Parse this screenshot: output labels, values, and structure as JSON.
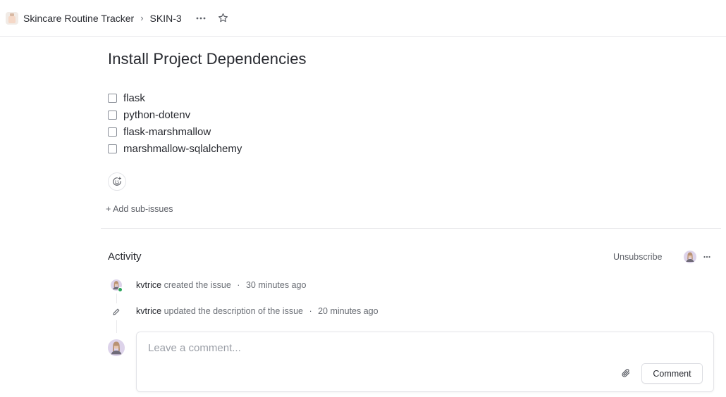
{
  "header": {
    "project_name": "Skincare Routine Tracker",
    "separator": "›",
    "issue_id": "SKIN-3"
  },
  "issue": {
    "title": "Install Project Dependencies",
    "checklist": [
      {
        "label": "flask",
        "checked": false
      },
      {
        "label": "python-dotenv",
        "checked": false
      },
      {
        "label": "flask-marshmallow",
        "checked": false
      },
      {
        "label": "marshmallow-sqlalchemy",
        "checked": false
      }
    ],
    "add_sub_issues": "+ Add sub-issues"
  },
  "activity": {
    "title": "Activity",
    "unsubscribe": "Unsubscribe",
    "events": [
      {
        "actor": "kvtrice",
        "action": "created the issue",
        "separator": "·",
        "time": "30 minutes ago"
      },
      {
        "actor": "kvtrice",
        "action": "updated the description of the issue",
        "separator": "·",
        "time": "20 minutes ago"
      }
    ]
  },
  "comment": {
    "placeholder": "Leave a comment...",
    "submit_label": "Comment"
  },
  "icons": {
    "more": "more-horizontal-icon",
    "favorite": "star-icon",
    "reaction": "emoji-add-icon",
    "attach": "paperclip-icon",
    "edit": "pencil-icon"
  },
  "colors": {
    "text": "#282a30",
    "muted": "#6b6f76",
    "border": "#e9e9ec",
    "online": "#29a35a",
    "avatar_bg": "#d9cfe8"
  }
}
